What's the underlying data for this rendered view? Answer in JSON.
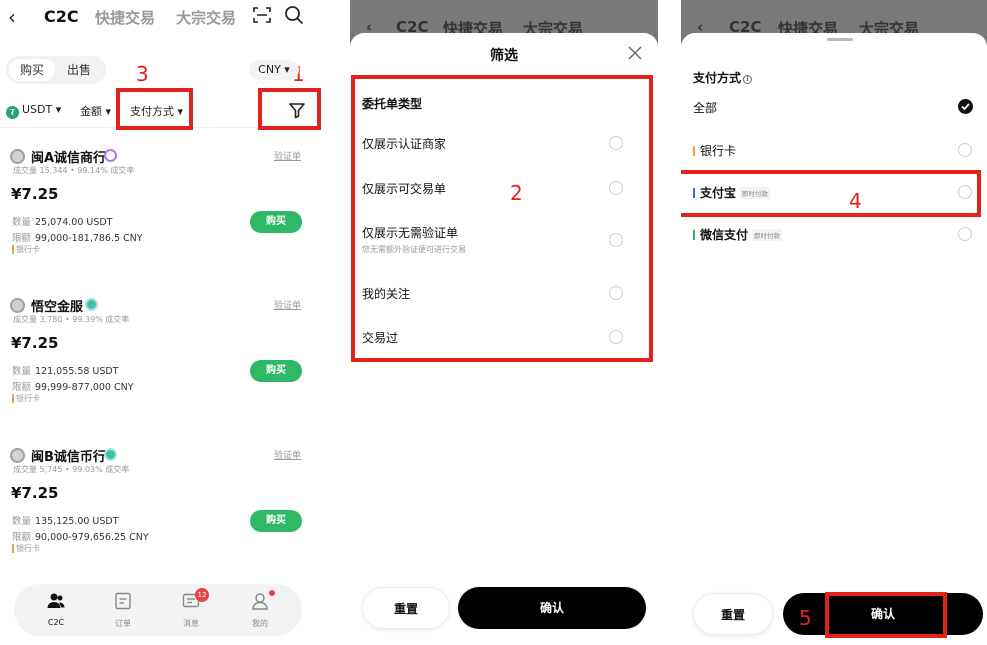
{
  "panel1": {
    "nav": {
      "back": "‹",
      "tabs": [
        "C2C",
        "快捷交易",
        "大宗交易"
      ]
    },
    "segment": {
      "buy": "购买",
      "sell": "出售"
    },
    "currency": "CNY ▾",
    "filters": {
      "coin": "USDT ▾",
      "amount": "金额 ▾",
      "payment": "支付方式 ▾"
    },
    "steps": {
      "s1": "1",
      "s3": "3"
    },
    "listings": [
      {
        "name": "闽A诚信商行",
        "badge_color": "#b07be6",
        "verify": "验证单",
        "stats": "成交量 15,344 • 99.14% 成交率",
        "price": "¥7.25",
        "qty_label": "数量",
        "qty": "25,074.00 USDT",
        "limit_label": "限额",
        "limit": "99,000-181,786.5 CNY",
        "method": "银行卡",
        "buy": "购买"
      },
      {
        "name": "悟空金服",
        "badge_color": "#3dbfa8",
        "verify": "验证单",
        "stats": "成交量 3,780 • 99.39% 成交率",
        "price": "¥7.25",
        "qty_label": "数量",
        "qty": "121,055.58 USDT",
        "limit_label": "限额",
        "limit": "99,999-877,000 CNY",
        "method": "银行卡",
        "buy": "购买"
      },
      {
        "name": "闽B诚信币行",
        "badge_color": "#3dbfa8",
        "verify": "验证单",
        "stats": "成交量 5,745 • 99.03% 成交率",
        "price": "¥7.25",
        "qty_label": "数量",
        "qty": "135,125.00 USDT",
        "limit_label": "限额",
        "limit": "90,000-979,656.25 CNY",
        "method": "银行卡",
        "buy": "购买"
      }
    ],
    "bottom_nav": [
      {
        "label": "C2C"
      },
      {
        "label": "订单"
      },
      {
        "label": "消息",
        "badge": "12"
      },
      {
        "label": "我的"
      }
    ]
  },
  "panel2": {
    "dim_tabs": [
      "C2C",
      "快捷交易",
      "大宗交易"
    ],
    "title": "筛选",
    "section": "委托单类型",
    "options": [
      {
        "label": "仅展示认证商家",
        "sub": ""
      },
      {
        "label": "仅展示可交易单",
        "sub": ""
      },
      {
        "label": "仅展示无需验证单",
        "sub": "您无需额外验证便可进行交易"
      },
      {
        "label": "我的关注",
        "sub": ""
      },
      {
        "label": "交易过",
        "sub": ""
      }
    ],
    "reset": "重置",
    "confirm": "确认",
    "step": "2"
  },
  "panel3": {
    "dim_tabs": [
      "C2C",
      "快捷交易",
      "大宗交易"
    ],
    "title": "支付方式",
    "options": [
      {
        "label": "全部",
        "tag": "",
        "bar": "",
        "selected": true
      },
      {
        "label": "银行卡",
        "tag": "",
        "bar": "#e8a24a",
        "selected": false
      },
      {
        "label": "支付宝",
        "tag": "即时付款",
        "bar": "#2f6fd6",
        "selected": false
      },
      {
        "label": "微信支付",
        "tag": "即时付款",
        "bar": "#2fb866",
        "selected": false
      }
    ],
    "reset": "重置",
    "confirm": "确认",
    "steps": {
      "s4": "4",
      "s5": "5"
    }
  },
  "colors": {
    "accent_red": "#e3221b",
    "buy_green": "#2fb866",
    "black": "#000000"
  }
}
